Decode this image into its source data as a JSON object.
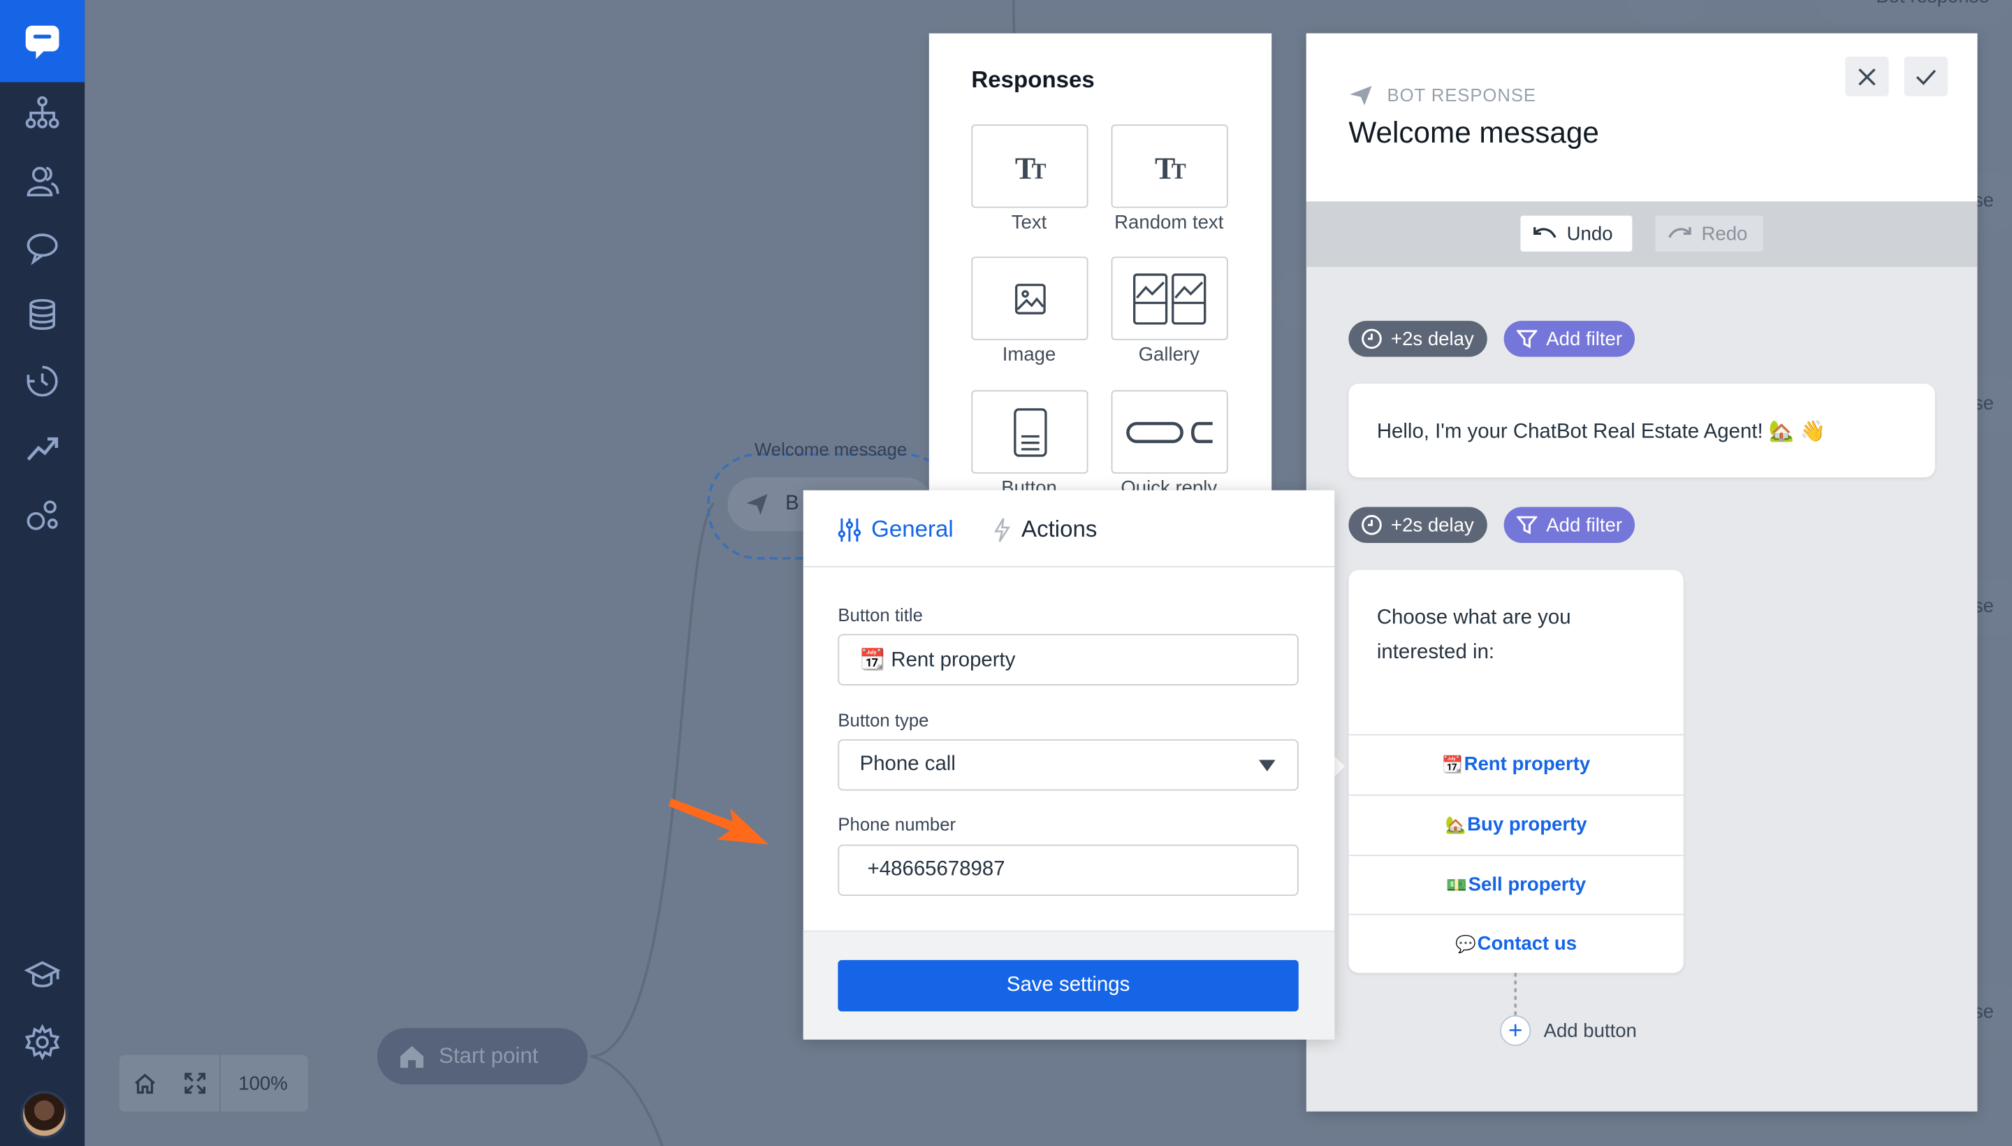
{
  "canvas": {
    "start_point": "Start point",
    "zoom": "100%",
    "ghost_node_title": "Welcome message",
    "ghost_node_label": "B",
    "background_nodes": [
      "Bot response",
      "se",
      "se",
      "se",
      "se"
    ]
  },
  "responses_panel": {
    "title": "Responses",
    "tiles": [
      {
        "label": "Text",
        "icon": "text-icon"
      },
      {
        "label": "Random text",
        "icon": "random-text-icon"
      },
      {
        "label": "Image",
        "icon": "image-icon"
      },
      {
        "label": "Gallery",
        "icon": "gallery-icon"
      },
      {
        "label": "Button",
        "icon": "button-icon"
      },
      {
        "label": "Quick reply",
        "icon": "quick-reply-icon"
      }
    ]
  },
  "bot_panel": {
    "kind": "BOT RESPONSE",
    "title": "Welcome message",
    "undo": "Undo",
    "redo": "Redo",
    "delay_1": "+2s delay",
    "filter_1": "Add filter",
    "message_1": "Hello, I'm your ChatBot Real Estate Agent! 🏡 👋",
    "delay_2": "+2s delay",
    "filter_2": "Add filter",
    "message_2": "Choose what are you interested in:",
    "options": [
      {
        "emoji": "📆",
        "label": "Rent property"
      },
      {
        "emoji": "🏡",
        "label": "Buy property"
      },
      {
        "emoji": "💵",
        "label": "Sell property"
      },
      {
        "emoji": "💬",
        "label": "Contact us"
      }
    ],
    "add_button": "Add button"
  },
  "settings": {
    "tab_general": "General",
    "tab_actions": "Actions",
    "button_title_label": "Button title",
    "button_title_value": "📆 Rent property",
    "button_type_label": "Button type",
    "button_type_value": "Phone call",
    "phone_label": "Phone number",
    "phone_value": "+48665678987",
    "save": "Save settings"
  },
  "colors": {
    "accent": "#1565e6",
    "sidebar": "#1f2d47",
    "filter_chip": "#7576d9",
    "delay_chip": "#5d6676",
    "arrow": "#ff6a1a"
  }
}
